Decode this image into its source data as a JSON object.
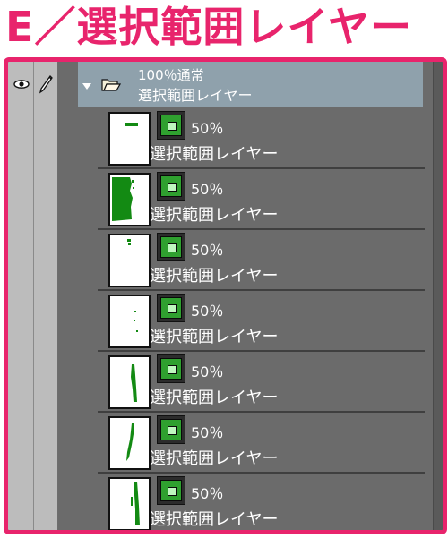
{
  "header": {
    "title": "E／選択範囲レイヤー"
  },
  "folder": {
    "opacity_mode": "100％通常",
    "name": "選択範囲レイヤー"
  },
  "layers": [
    {
      "opacity": "50％",
      "name": "選択範囲レイヤー"
    },
    {
      "opacity": "50％",
      "name": "選択範囲レイヤー"
    },
    {
      "opacity": "50％",
      "name": "選択範囲レイヤー"
    },
    {
      "opacity": "50％",
      "name": "選択範囲レイヤー"
    },
    {
      "opacity": "50％",
      "name": "選択範囲レイヤー"
    },
    {
      "opacity": "50％",
      "name": "選択範囲レイヤー"
    },
    {
      "opacity": "50％",
      "name": "選択範囲レイヤー"
    }
  ],
  "colors": {
    "accent": "#e8246c",
    "mask_green": "#2fa02f",
    "selection_green": "#138a13",
    "folder_bg": "#8fa1ac",
    "panel_bg": "#6b6b6b"
  },
  "icons": [
    "eye-icon",
    "pen-icon",
    "chevron-down-icon",
    "folder-icon",
    "layer-mask-icon"
  ]
}
